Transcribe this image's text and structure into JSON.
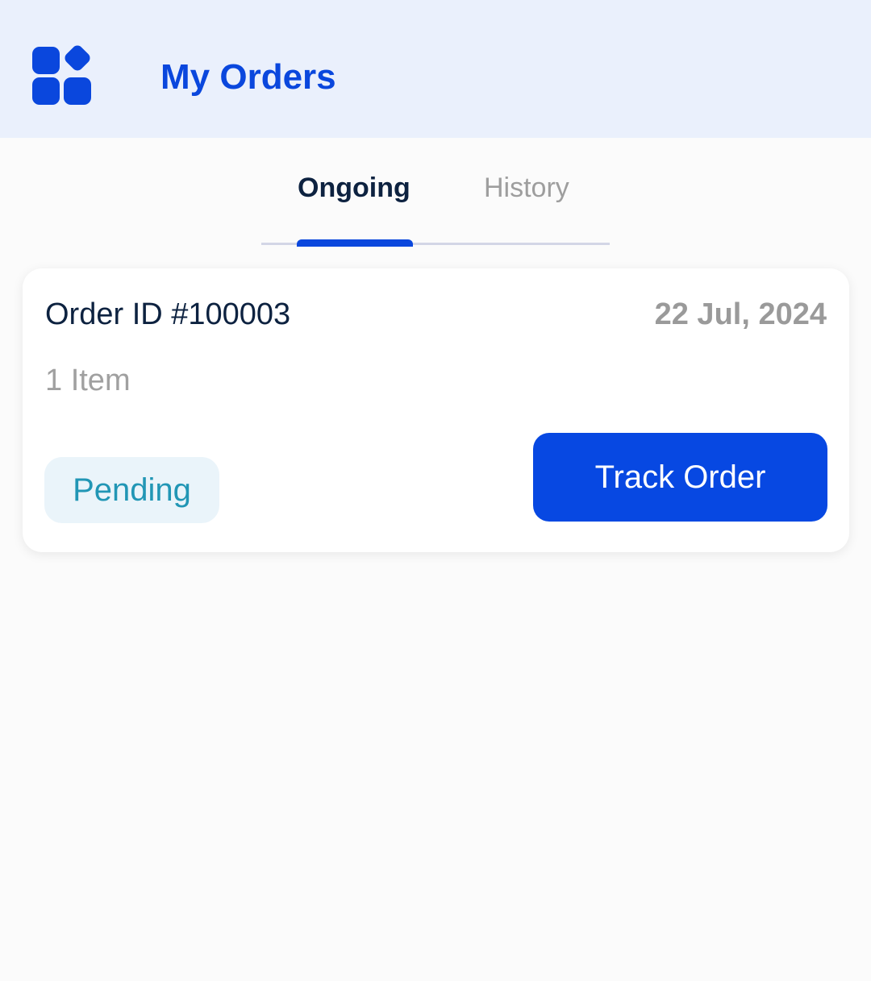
{
  "header": {
    "title": "My Orders",
    "icon": "apps-grid-icon",
    "accent_color": "#0A47DD",
    "background_color": "#EAF0FC"
  },
  "tabs": [
    {
      "label": "Ongoing",
      "active": true
    },
    {
      "label": "History",
      "active": false
    }
  ],
  "orders": [
    {
      "order_id": "Order ID #100003",
      "date": "22 Jul, 2024",
      "items": "1 Item",
      "status": "Pending",
      "status_color": "#2196B5",
      "action_label": "Track Order",
      "action_color": "#0748E2"
    }
  ]
}
